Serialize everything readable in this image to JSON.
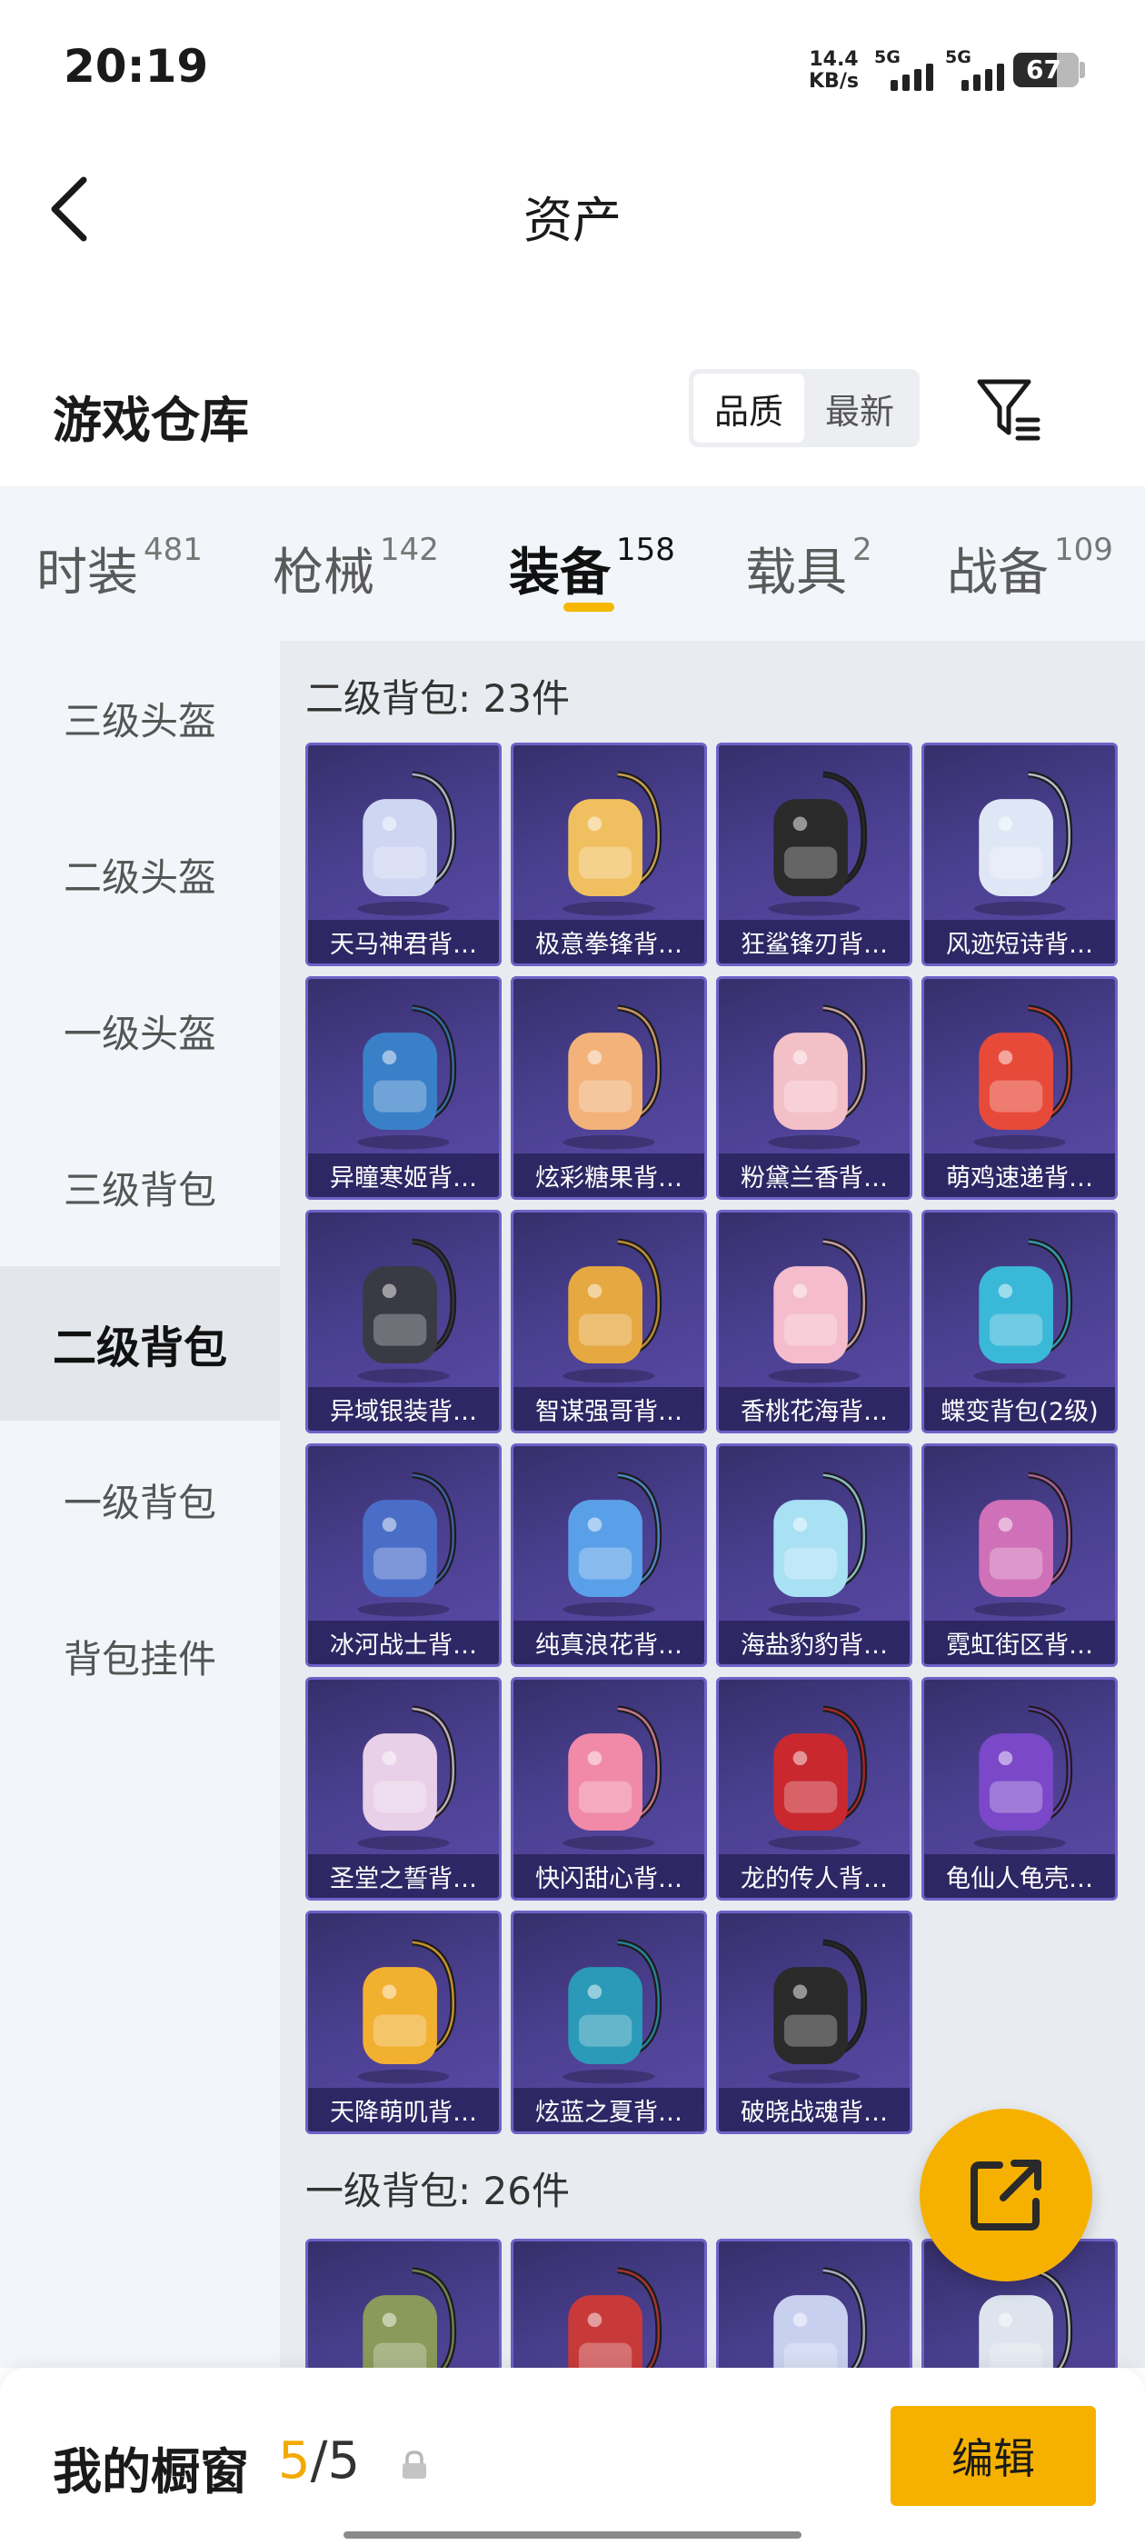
{
  "status_bar": {
    "time": "20:19",
    "net_speed_value": "14.4",
    "net_speed_unit": "KB/s",
    "signal1_label": "5G",
    "signal2_label": "5G",
    "battery": "67",
    "battery_level": 0.67
  },
  "header": {
    "title": "资产",
    "back_icon": "chevron-left-icon"
  },
  "warehouse": {
    "title": "游戏仓库",
    "sort_options": [
      "品质",
      "最新"
    ],
    "active_sort": "品质",
    "filter_icon": "filter-icon"
  },
  "tabs": [
    {
      "label": "时装",
      "count": "481"
    },
    {
      "label": "枪械",
      "count": "142"
    },
    {
      "label": "装备",
      "count": "158",
      "active": true
    },
    {
      "label": "载具",
      "count": "2"
    },
    {
      "label": "战备",
      "count": "109"
    }
  ],
  "left_nav": [
    "三级头盔",
    "二级头盔",
    "一级头盔",
    "三级背包",
    "二级背包",
    "一级背包",
    "背包挂件"
  ],
  "active_nav": "二级背包",
  "sections": [
    {
      "title": "二级背包: 23件",
      "items": [
        "天马神君背…",
        "极意拳锋背…",
        "狂鲨锋刃背…",
        "风迹短诗背…",
        "异瞳寒姬背…",
        "炫彩糖果背…",
        "粉黛兰香背…",
        "萌鸡速递背…",
        "异域银装背…",
        "智谋强哥背…",
        "香桃花海背…",
        "蝶变背包(2级)",
        "冰河战士背…",
        "纯真浪花背…",
        "海盐豹豹背…",
        "霓虹街区背…",
        "圣堂之誓背…",
        "快闪甜心背…",
        "龙的传人背…",
        "龟仙人龟壳…",
        "天降萌叽背…",
        "炫蓝之夏背…",
        "破晓战魂背…"
      ]
    },
    {
      "title": "一级背包: 26件",
      "items": [
        "",
        "",
        "",
        ""
      ]
    }
  ],
  "item_colors": [
    "#cfd6f2",
    "#f0c060",
    "#2a2a2a",
    "#dfe6f5",
    "#3a80c8",
    "#f2b27a",
    "#f4c0c8",
    "#e84a3a",
    "#3a3a44",
    "#e6a840",
    "#f4bccc",
    "#3ab8d8",
    "#4a6ec8",
    "#5aa0e8",
    "#a8e0f4",
    "#d070b8",
    "#e8d0e8",
    "#f08aa8",
    "#c8282e",
    "#7a48c8",
    "#f2b030",
    "#2a9ab8",
    "#2a2a2a",
    "#8a9a5a",
    "#c83a3a",
    "#c8d0f0",
    "#dde4ee"
  ],
  "fab": {
    "icon": "share-icon"
  },
  "bottom_bar": {
    "label": "我的橱窗",
    "current": "5",
    "separator": "/",
    "total": "5",
    "lock_icon": "lock-icon",
    "edit_label": "编辑"
  }
}
